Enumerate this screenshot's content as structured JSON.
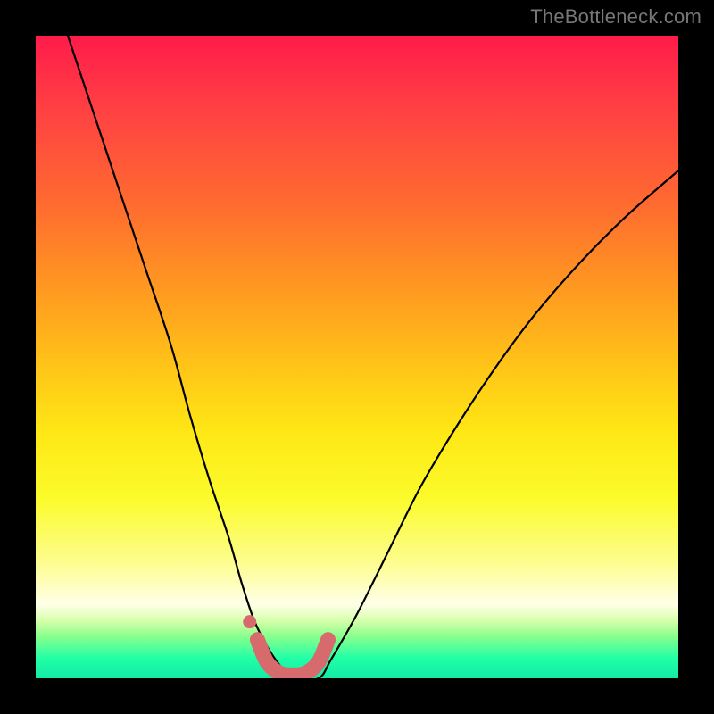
{
  "watermark": "TheBottleneck.com",
  "colors": {
    "curve_black": "#000000",
    "bottom_pink": "#d76a6d",
    "bottom_pink_dot": "#d76a6d"
  },
  "chart_data": {
    "type": "line",
    "title": "",
    "xlabel": "",
    "ylabel": "",
    "xlim": [
      0,
      100
    ],
    "ylim": [
      0,
      100
    ],
    "series": [
      {
        "name": "bottleneck-curve",
        "x": [
          5,
          9,
          13,
          17,
          21,
          24,
          27,
          30,
          32,
          34,
          36,
          38,
          40,
          44,
          46,
          50,
          55,
          60,
          66,
          72,
          78,
          85,
          92,
          100
        ],
        "values": [
          100,
          88,
          76,
          64,
          52,
          41,
          31,
          22,
          15,
          9,
          5,
          2,
          0,
          0,
          3,
          10,
          20,
          30,
          40,
          49,
          57,
          65,
          72,
          79
        ]
      }
    ],
    "annotations": [
      {
        "name": "bottom-arc-highlight",
        "type": "overlay-path",
        "x": [
          34.5,
          36,
          38,
          40,
          42,
          44,
          45.5
        ],
        "values": [
          6,
          2.5,
          0.8,
          0.5,
          0.8,
          2.5,
          6
        ]
      },
      {
        "name": "bottom-arc-dot",
        "type": "point",
        "x": 33.3,
        "value": 8.8
      }
    ]
  }
}
